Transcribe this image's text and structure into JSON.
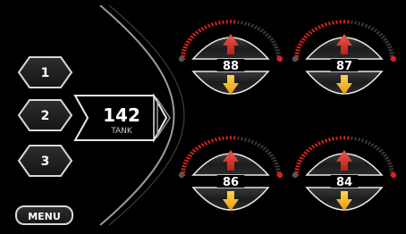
{
  "preset_buttons": [
    {
      "label": "1"
    },
    {
      "label": "2"
    },
    {
      "label": "3"
    }
  ],
  "menu": {
    "label": "MENU"
  },
  "tank": {
    "value": "142",
    "label": "TANK"
  },
  "gauges": [
    {
      "value": "88"
    },
    {
      "value": "87"
    },
    {
      "value": "86"
    },
    {
      "value": "84"
    }
  ],
  "colors": {
    "background": "#000000",
    "panel_outline": "#e8e8e8",
    "up_arrow": "#e53a2f",
    "down_arrow": "#f5b51c",
    "arc_red": "#d4231c",
    "end_dot": "#e11b1b"
  },
  "icons": {
    "up": "up-arrow-icon",
    "down": "down-arrow-icon"
  }
}
